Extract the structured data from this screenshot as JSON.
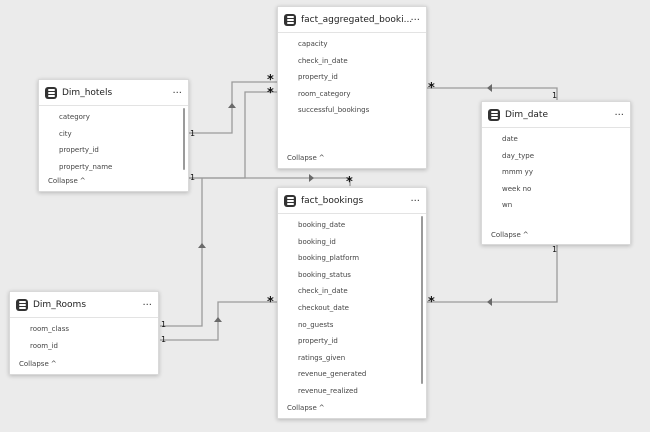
{
  "tables": {
    "fact_agg": {
      "title": "fact_aggregated_booki...",
      "fields": [
        "capacity",
        "check_in_date",
        "property_id",
        "room_category",
        "successful_bookings"
      ],
      "collapse": "Collapse"
    },
    "dim_hotels": {
      "title": "Dim_hotels",
      "fields": [
        "category",
        "city",
        "property_id",
        "property_name"
      ],
      "collapse": "Collapse"
    },
    "dim_date": {
      "title": "Dim_date",
      "fields": [
        "date",
        "day_type",
        "mmm yy",
        "week no",
        "wn"
      ],
      "collapse": "Collapse"
    },
    "fact_bookings": {
      "title": "fact_bookings",
      "fields": [
        "booking_date",
        "booking_id",
        "booking_platform",
        "booking_status",
        "check_in_date",
        "checkout_date",
        "no_guests",
        "property_id",
        "ratings_given",
        "revenue_generated",
        "revenue_realized"
      ],
      "collapse": "Collapse"
    },
    "dim_rooms": {
      "title": "Dim_Rooms",
      "fields": [
        "room_class",
        "room_id"
      ],
      "collapse": "Collapse"
    }
  },
  "ui": {
    "more": "...",
    "caret": "^"
  },
  "cardinality": {
    "one": "1",
    "many": "*"
  },
  "colors": {
    "line": "#9b9b9b",
    "arrow": "#6a6a6a",
    "icon": "#333333"
  }
}
